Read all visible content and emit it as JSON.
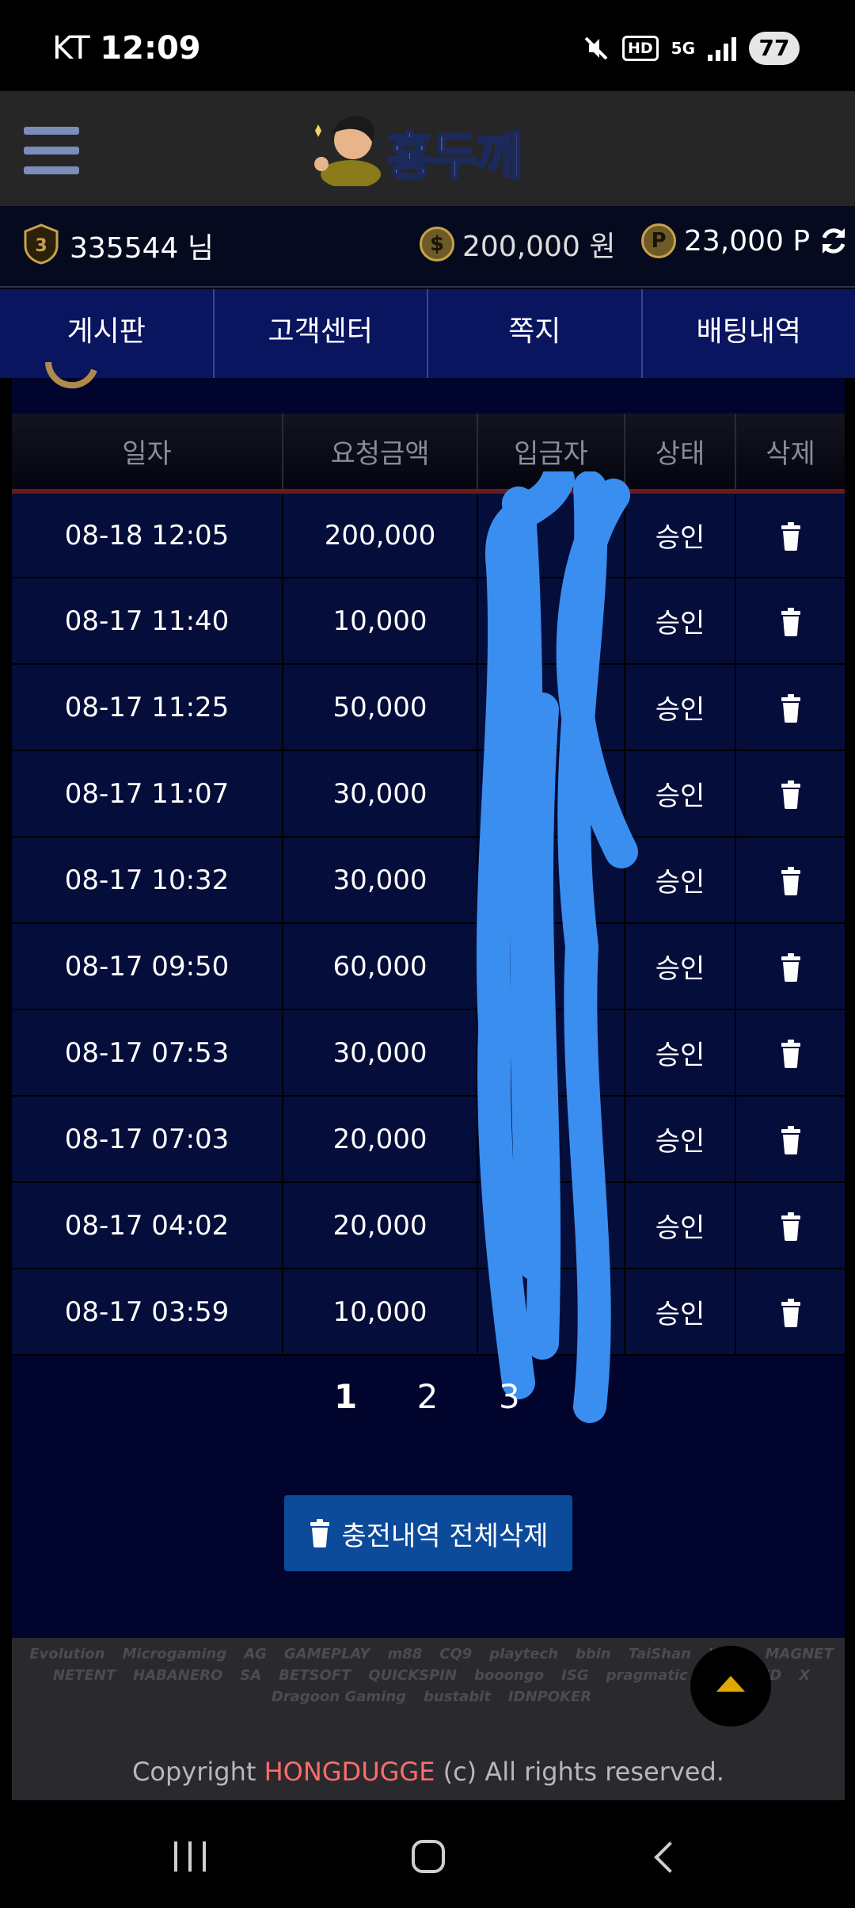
{
  "statusbar": {
    "carrier": "KT",
    "time": "12:09",
    "hd_label": "HD",
    "network_label": "5G",
    "battery": "77"
  },
  "header": {
    "logo_text": "홍두깨"
  },
  "userbar": {
    "level": "3",
    "username": "335544 님",
    "money": "200,000 원",
    "points": "23,000 P",
    "money_icon": "$",
    "points_icon": "P"
  },
  "nav_tabs": [
    "게시판",
    "고객센터",
    "쪽지",
    "배팅내역"
  ],
  "table": {
    "headers": [
      "일자",
      "요청금액",
      "입금자",
      "상태",
      "삭제"
    ],
    "rows": [
      {
        "date": "08-18 12:05",
        "amount": "200,000",
        "status": "승인"
      },
      {
        "date": "08-17 11:40",
        "amount": "10,000",
        "status": "승인"
      },
      {
        "date": "08-17 11:25",
        "amount": "50,000",
        "status": "승인"
      },
      {
        "date": "08-17 11:07",
        "amount": "30,000",
        "status": "승인"
      },
      {
        "date": "08-17 10:32",
        "amount": "30,000",
        "status": "승인"
      },
      {
        "date": "08-17 09:50",
        "amount": "60,000",
        "status": "승인"
      },
      {
        "date": "08-17 07:53",
        "amount": "30,000",
        "status": "승인"
      },
      {
        "date": "08-17 07:03",
        "amount": "20,000",
        "status": "승인"
      },
      {
        "date": "08-17 04:02",
        "amount": "20,000",
        "status": "승인"
      },
      {
        "date": "08-17 03:59",
        "amount": "10,000",
        "status": "승인"
      }
    ]
  },
  "pagination": [
    "1",
    "2",
    "3"
  ],
  "delete_all_label": "충전내역 전체삭제",
  "footer": {
    "providers": [
      "Evolution",
      "Microgaming",
      "AG",
      "GAMEPLAY",
      "m88",
      "CQ9",
      "playtech",
      "bbin",
      "TaiShan",
      "VIVO",
      "MAGNET",
      "NETENT",
      "HABANERO",
      "SA",
      "BETSOFT",
      "QUICKSPIN",
      "booongo",
      "ISG",
      "pragmatic",
      "SKYWIND",
      "X",
      "Dragoon Gaming",
      "bustabit",
      "IDNPOKER"
    ],
    "copyright_prefix": "Copyright",
    "copyright_brand": "HONGDUGGE",
    "copyright_suffix": "(c) All rights reserved."
  },
  "colors": {
    "accent_blue": "#0c4a9a",
    "nav_bg": "#0a1560",
    "table_bg": "#050d3a",
    "brand_red": "#ff6b6b",
    "scribble": "#3a8ef0"
  }
}
